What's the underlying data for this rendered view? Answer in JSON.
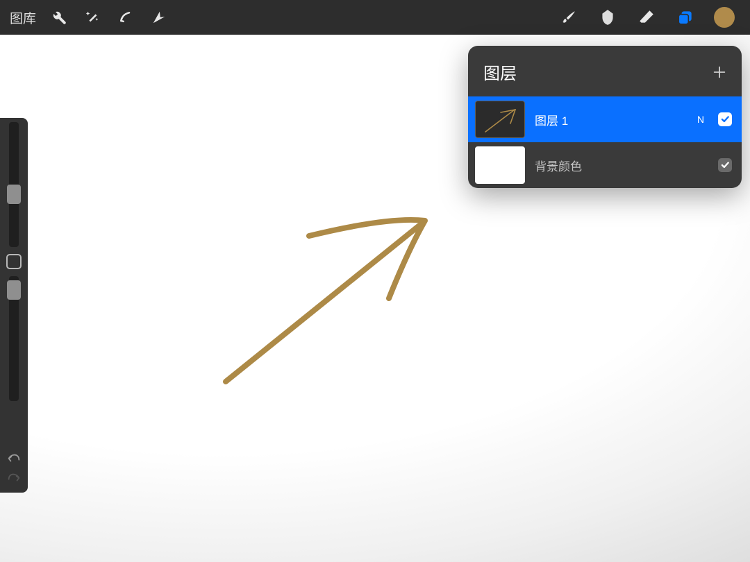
{
  "topbar": {
    "gallery_label": "图库",
    "color": "#b08b4b"
  },
  "layers_panel": {
    "title": "图层",
    "layers": [
      {
        "name": "图层 1",
        "blend_short": "N",
        "visible": true,
        "selected": true
      },
      {
        "name": "背景颜色",
        "visible": true,
        "selected": false
      }
    ]
  }
}
